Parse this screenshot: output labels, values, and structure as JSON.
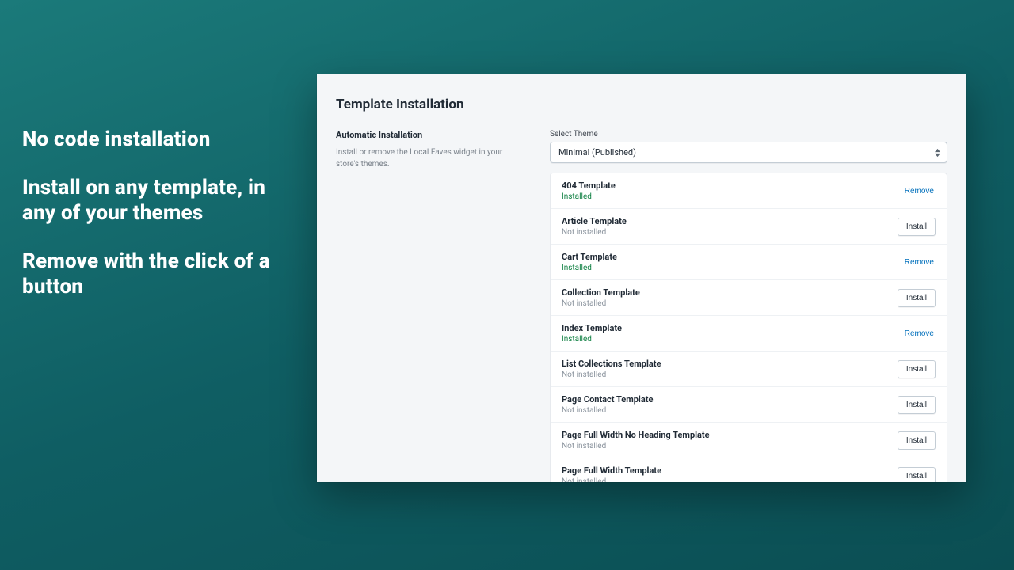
{
  "hero": {
    "line1": "No code installation",
    "line2": "Install on any template, in any of your themes",
    "line3": "Remove with the click of a button"
  },
  "panel": {
    "title": "Template Installation",
    "section_heading": "Automatic Installation",
    "section_help": "Install or remove the Local Faves widget in your store's themes.",
    "select_label": "Select Theme",
    "select_value": "Minimal (Published)",
    "install_label": "Install",
    "remove_label": "Remove",
    "status_installed": "Installed",
    "status_not_installed": "Not installed"
  },
  "templates": [
    {
      "name": "404 Template",
      "installed": true
    },
    {
      "name": "Article Template",
      "installed": false
    },
    {
      "name": "Cart Template",
      "installed": true
    },
    {
      "name": "Collection Template",
      "installed": false
    },
    {
      "name": "Index Template",
      "installed": true
    },
    {
      "name": "List Collections Template",
      "installed": false
    },
    {
      "name": "Page Contact Template",
      "installed": false
    },
    {
      "name": "Page Full Width No Heading Template",
      "installed": false
    },
    {
      "name": "Page Full Width Template",
      "installed": false
    }
  ],
  "peek_partial": ""
}
